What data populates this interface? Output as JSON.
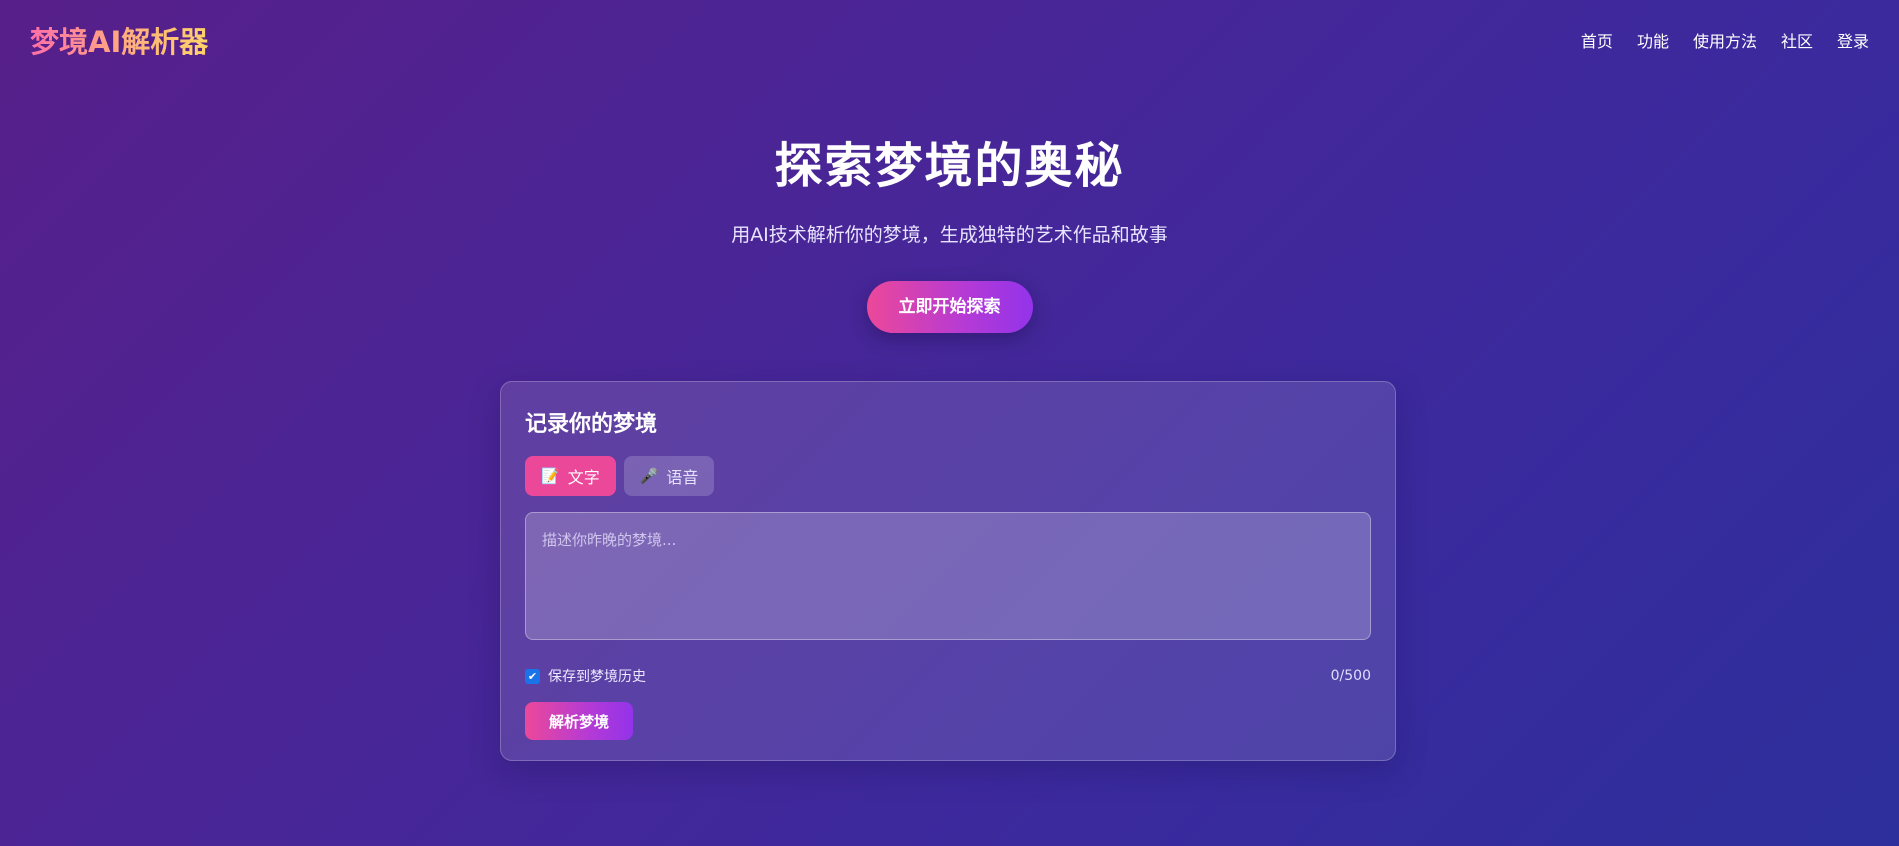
{
  "brand": {
    "logo": "梦境AI解析器"
  },
  "nav": {
    "links": [
      "首页",
      "功能",
      "使用方法",
      "社区",
      "登录"
    ]
  },
  "hero": {
    "title": "探索梦境的奥秘",
    "subtitle": "用AI技术解析你的梦境，生成独特的艺术作品和故事",
    "cta_label": "立即开始探索"
  },
  "recorder": {
    "title": "记录你的梦境",
    "tabs": [
      {
        "icon": "memo-icon",
        "glyph": "📝",
        "label": "文字",
        "active": true
      },
      {
        "icon": "microphone-icon",
        "glyph": "🎤",
        "label": "语音",
        "active": false
      }
    ],
    "input_value": "",
    "input_placeholder": "描述你昨晚的梦境...",
    "save_history_label": "保存到梦境历史",
    "save_history_checked": true,
    "char_count": "0/500",
    "submit_label": "解析梦境"
  },
  "colors": {
    "accent_pink": "#ec4899",
    "accent_purple": "#9333ea",
    "bg_start": "#571f8a",
    "bg_end": "#2d2f9c",
    "checkbox_blue": "#1a73e8"
  }
}
